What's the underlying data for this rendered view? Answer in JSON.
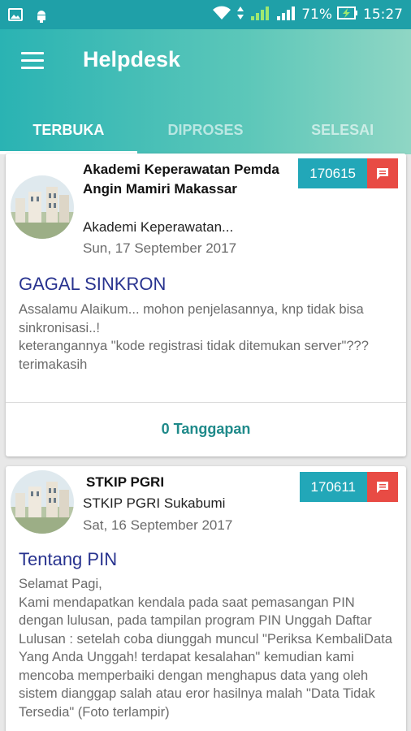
{
  "status_bar": {
    "battery": "71%",
    "time": "15:27"
  },
  "app_bar": {
    "title": "Helpdesk",
    "menu_icon": "hamburger-menu-icon"
  },
  "tabs": [
    {
      "label": "TERBUKA",
      "active": true
    },
    {
      "label": "DIPROSES",
      "active": false
    },
    {
      "label": "SELESAI",
      "active": false
    }
  ],
  "tickets": [
    {
      "institution": "Akademi Keperawatan Pemda Angin Mamiri Makassar",
      "institution_sub": "Akademi Keperawatan...",
      "date": "Sun, 17 September 2017",
      "ticket_no": "170615",
      "subject": "GAGAL SINKRON",
      "message": "Assalamu Alaikum... mohon penjelasannya, knp tidak bisa sinkronisasi..!\nketerangannya \"kode registrasi tidak ditemukan server\"???\nterimakasih",
      "replies": "0 Tanggapan"
    },
    {
      "institution": "STKIP PGRI",
      "institution_sub": "STKIP PGRI Sukabumi",
      "date": "Sat, 16 September 2017",
      "ticket_no": "170611",
      "subject": "Tentang PIN",
      "message": "Selamat Pagi,\nKami mendapatkan kendala pada saat pemasangan PIN dengan lulusan, pada tampilan program PIN Unggah Daftar Lulusan : setelah coba diunggah muncul \"Periksa KembaliData Yang Anda Unggah! terdapat kesalahan\" kemudian kami mencoba memperbaiki dengan menghapus data yang oleh sistem dianggap salah atau eror hasilnya malah \"Data Tidak Tersedia\" (Foto terlampir)"
    }
  ],
  "colors": {
    "accent": "#22a7b8",
    "chat_badge": "#e84b44",
    "subject": "#28338f"
  }
}
